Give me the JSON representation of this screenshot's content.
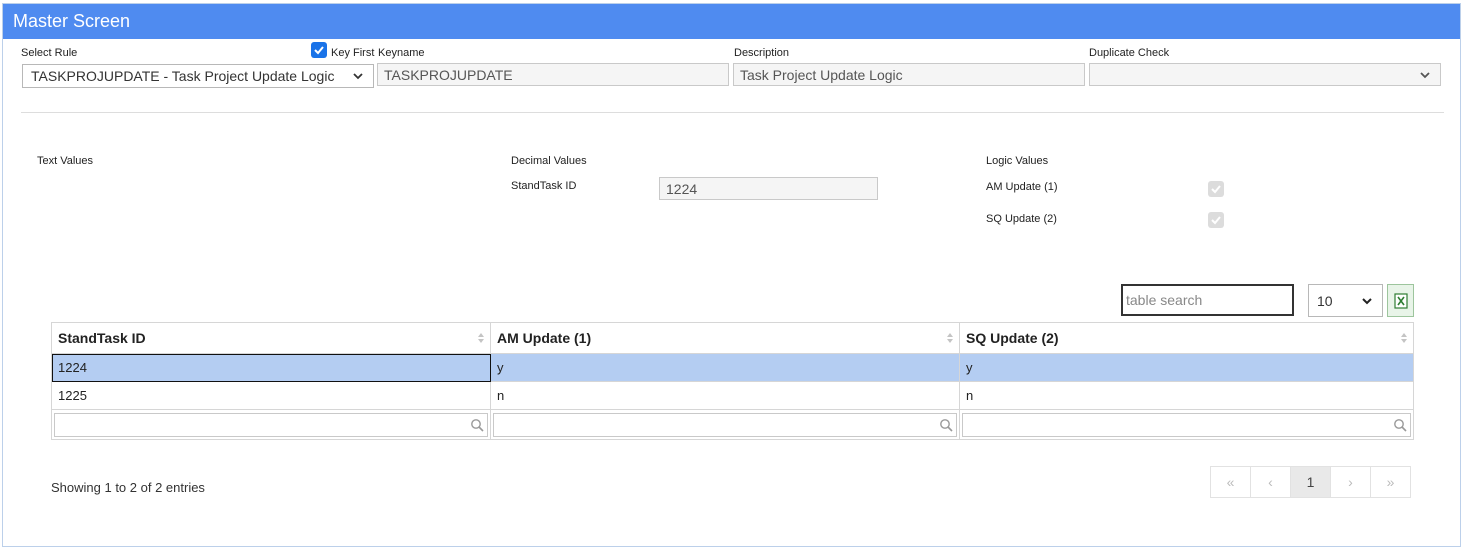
{
  "window": {
    "title": "Master Screen"
  },
  "header": {
    "select_rule_label": "Select Rule",
    "select_rule_value": "TASKPROJUPDATE - Task Project Update Logic",
    "key_first_label": "Key First",
    "key_first_checked": true,
    "keyname_label": "Keyname",
    "keyname_value": "TASKPROJUPDATE",
    "description_label": "Description",
    "description_value": "Task Project Update Logic",
    "duplicate_check_label": "Duplicate Check",
    "duplicate_check_value": ""
  },
  "sections": {
    "text_values_label": "Text Values",
    "decimal_values_label": "Decimal Values",
    "standtask_label": "StandTask ID",
    "standtask_value": "1224",
    "logic_values_label": "Logic Values",
    "am_update_label": "AM Update (1)",
    "am_update_checked": true,
    "sq_update_label": "SQ Update (2)",
    "sq_update_checked": true
  },
  "table_controls": {
    "search_placeholder": "table search",
    "page_size": "10",
    "excel_icon": "excel-export-icon"
  },
  "table": {
    "columns": [
      "StandTask ID",
      "AM Update (1)",
      "SQ Update (2)"
    ],
    "rows": [
      [
        "1224",
        "y",
        "y"
      ],
      [
        "1225",
        "n",
        "n"
      ]
    ],
    "selected_row": 0
  },
  "footer": {
    "info": "Showing 1 to 2 of 2 entries",
    "pager": {
      "first": "«",
      "prev": "‹",
      "current": "1",
      "next": "›",
      "last": "»"
    }
  },
  "colors": {
    "titlebar": "#4f8bf0",
    "selected_row": "#b4cdf2",
    "checkbox_on": "#1a73e8"
  }
}
